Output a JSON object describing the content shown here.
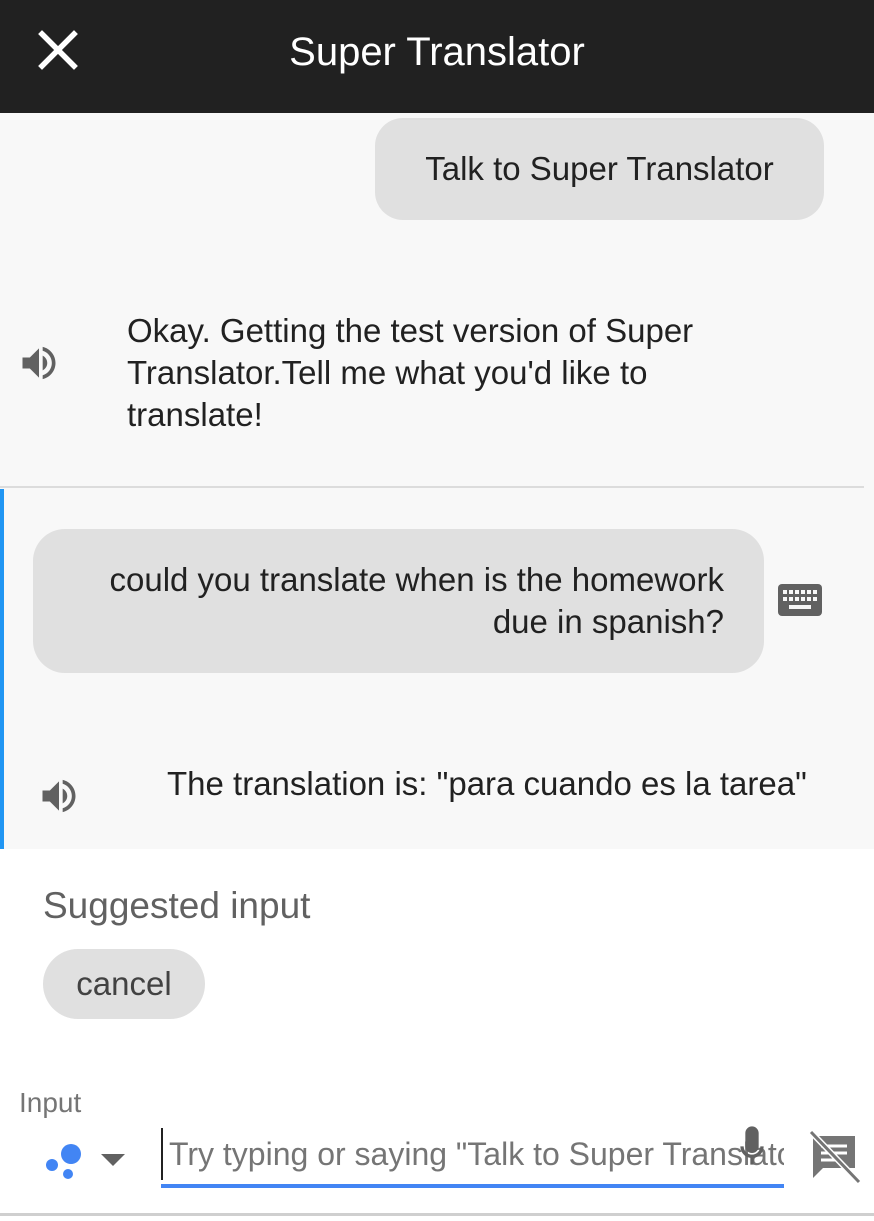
{
  "appbar": {
    "title": "Super Translator",
    "close_icon": "close-icon"
  },
  "conversation": {
    "user_message_1": "Talk to Super Translator",
    "reply_1": "Okay. Getting the test version of Super Translator.Tell me what you'd like to translate!",
    "user_message_2": "could you translate when is the homework due in spanish?",
    "reply_2": "The translation is: \"para cuando es la tarea\"",
    "icons": [
      "speaker-icon",
      "keyboard-icon"
    ]
  },
  "suggestions": {
    "heading": "Suggested input",
    "chips": [
      "cancel"
    ]
  },
  "input": {
    "label": "Input",
    "placeholder": "Try typing or saying \"Talk to Super Translator\"",
    "value": "",
    "icons": [
      "google-assistant-icon",
      "dropdown-arrow-icon",
      "microphone-icon",
      "speech-disabled-icon"
    ]
  },
  "colors": {
    "appbar": "#212121",
    "accent": "#2196f3",
    "underline": "#4285f4",
    "bubble": "#e0e0e0"
  }
}
